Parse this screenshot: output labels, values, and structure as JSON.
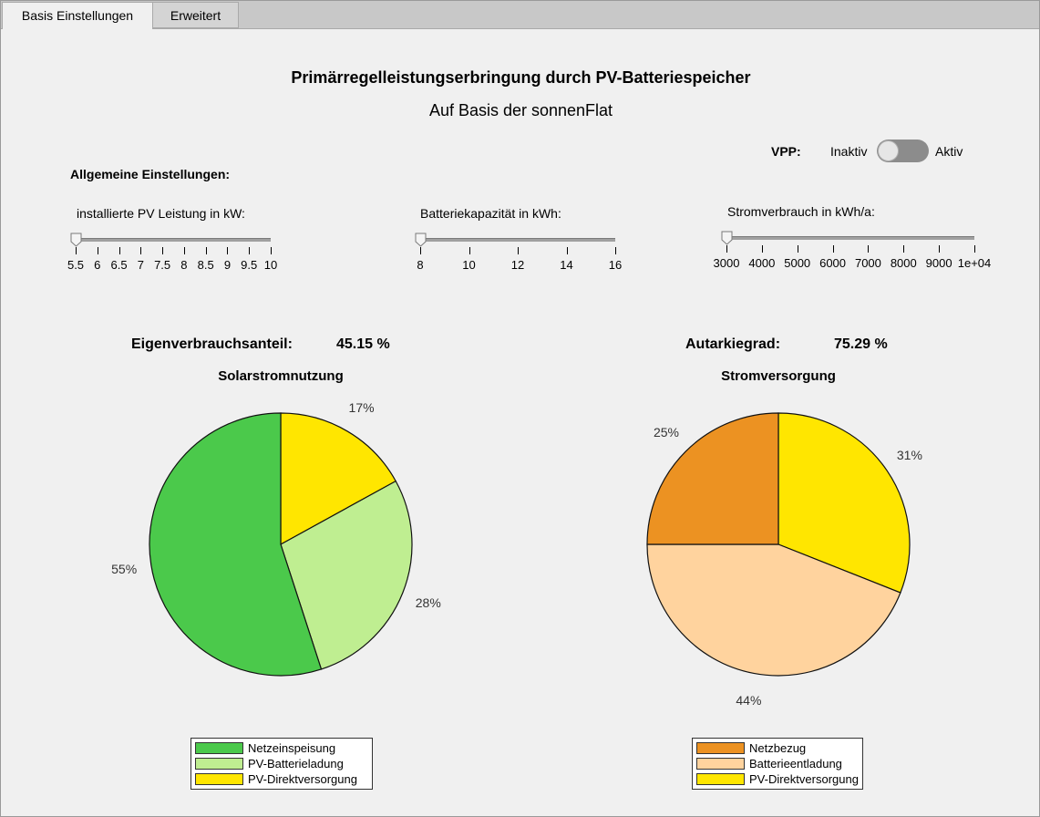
{
  "tabs": [
    {
      "label": "Basis Einstellungen"
    },
    {
      "label": "Erweitert"
    }
  ],
  "header": {
    "title": "Primärregelleistungserbringung durch PV-Batteriespeicher",
    "subtitle": "Auf Basis der sonnenFlat"
  },
  "vpp": {
    "label": "VPP:",
    "off_label": "Inaktiv",
    "on_label": "Aktiv",
    "state": "Inaktiv"
  },
  "settings": {
    "section_label": "Allgemeine Einstellungen:",
    "pv": {
      "label": "installierte PV Leistung in kW:",
      "value": 5.5,
      "ticks": [
        "5.5",
        "6",
        "6.5",
        "7",
        "7.5",
        "8",
        "8.5",
        "9",
        "9.5",
        "10"
      ]
    },
    "battery": {
      "label": "Batteriekapazität in kWh:",
      "value": 8,
      "ticks": [
        "8",
        "10",
        "12",
        "14",
        "16"
      ]
    },
    "consumption": {
      "label": "Stromverbrauch in kWh/a:",
      "value": 3000,
      "ticks": [
        "3000",
        "4000",
        "5000",
        "6000",
        "7000",
        "8000",
        "9000",
        "1e+04"
      ]
    }
  },
  "kpis": {
    "self_consumption_label": "Eigenverbrauchsanteil:",
    "self_consumption_value": "45.15 %",
    "autarky_label": "Autarkiegrad:",
    "autarky_value": "75.29 %"
  },
  "chart_data": [
    {
      "type": "pie",
      "title": "Solarstromnutzung",
      "slices": [
        {
          "name": "PV-Direktversorgung",
          "value": 17,
          "label": "17%",
          "color": "#ffe600"
        },
        {
          "name": "PV-Batterieladung",
          "value": 28,
          "label": "28%",
          "color": "#bfee91"
        },
        {
          "name": "Netzeinspeisung",
          "value": 55,
          "label": "55%",
          "color": "#4bc94b"
        }
      ],
      "legend": [
        "Netzeinspeisung",
        "PV-Batterieladung",
        "PV-Direktversorgung"
      ],
      "legend_colors": [
        "#4bc94b",
        "#bfee91",
        "#ffe600"
      ],
      "legend_position": "bottom"
    },
    {
      "type": "pie",
      "title": "Stromversorgung",
      "slices": [
        {
          "name": "PV-Direktversorgung",
          "value": 31,
          "label": "31%",
          "color": "#ffe600"
        },
        {
          "name": "Batterieentladung",
          "value": 44,
          "label": "44%",
          "color": "#ffd39e"
        },
        {
          "name": "Netzbezug",
          "value": 25,
          "label": "25%",
          "color": "#ec9222"
        }
      ],
      "legend": [
        "Netzbezug",
        "Batterieentladung",
        "PV-Direktversorgung"
      ],
      "legend_colors": [
        "#ec9222",
        "#ffd39e",
        "#ffe600"
      ],
      "legend_position": "bottom"
    }
  ]
}
